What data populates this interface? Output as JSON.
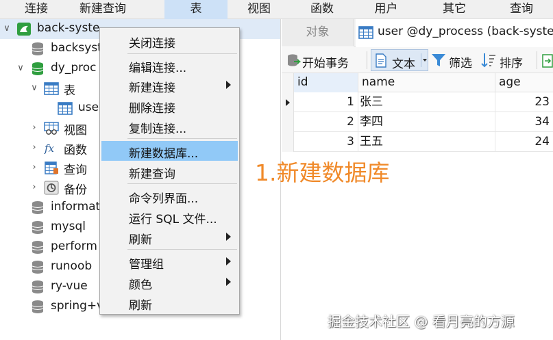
{
  "menubar": {
    "items": [
      {
        "label": "连接",
        "active": false
      },
      {
        "label": "新建查询",
        "active": false
      },
      {
        "label": "表",
        "active": true
      },
      {
        "label": "视图",
        "active": false
      },
      {
        "label": "函数",
        "active": false
      },
      {
        "label": "用户",
        "active": false
      },
      {
        "label": "其它",
        "active": false
      },
      {
        "label": "查询",
        "active": false
      }
    ]
  },
  "tree": {
    "connection": {
      "label": "back-syste",
      "icon": "connection-icon"
    },
    "databases_above": [
      {
        "label": "backsyst",
        "icon": "database-icon"
      }
    ],
    "open_db": {
      "label": "dy_proc",
      "icon": "database-open-icon"
    },
    "tables_node": {
      "label": "表",
      "icon": "table-folder-icon"
    },
    "table_item": {
      "label": "use",
      "icon": "table-icon"
    },
    "views_node": {
      "label": "视图",
      "icon": "view-icon"
    },
    "functions_node": {
      "label": "函数",
      "icon": "function-icon"
    },
    "queries_node": {
      "label": "查询",
      "icon": "query-icon"
    },
    "backup_node": {
      "label": "备份",
      "icon": "backup-icon"
    },
    "databases_below": [
      {
        "label": "informat",
        "icon": "database-icon"
      },
      {
        "label": "mysql",
        "icon": "database-icon"
      },
      {
        "label": "perform",
        "icon": "database-icon"
      },
      {
        "label": "runoob",
        "icon": "database-icon"
      },
      {
        "label": "ry-vue",
        "icon": "database-icon"
      },
      {
        "label": "spring+v",
        "icon": "database-icon"
      }
    ]
  },
  "tabs": {
    "objects_label": "对象",
    "table_tab_label": "user @dy_process (back-syste"
  },
  "toolbar": {
    "begin_transaction": "开始事务",
    "text": "文本",
    "filter": "筛选",
    "sort": "排序"
  },
  "grid": {
    "columns": [
      "id",
      "name",
      "age"
    ],
    "rows": [
      {
        "id": "1",
        "name": "张三",
        "age": "23",
        "current": true
      },
      {
        "id": "2",
        "name": "李四",
        "age": "34",
        "current": false
      },
      {
        "id": "3",
        "name": "王五",
        "age": "24",
        "current": false
      }
    ]
  },
  "context_menu": {
    "items": [
      {
        "label": "关闭连接",
        "submenu": false,
        "highlighted": false
      },
      {
        "label": "编辑连接...",
        "submenu": false,
        "highlighted": false
      },
      {
        "label": "新建连接",
        "submenu": true,
        "highlighted": false
      },
      {
        "label": "删除连接",
        "submenu": false,
        "highlighted": false
      },
      {
        "label": "复制连接...",
        "submenu": false,
        "highlighted": false
      },
      {
        "label": "新建数据库...",
        "submenu": false,
        "highlighted": true
      },
      {
        "label": "新建查询",
        "submenu": false,
        "highlighted": false
      },
      {
        "label": "命令列界面...",
        "submenu": false,
        "highlighted": false
      },
      {
        "label": "运行 SQL 文件...",
        "submenu": false,
        "highlighted": false
      },
      {
        "label": "刷新",
        "submenu": true,
        "highlighted": false
      },
      {
        "label": "管理组",
        "submenu": true,
        "highlighted": false
      },
      {
        "label": "颜色",
        "submenu": true,
        "highlighted": false
      },
      {
        "label": "刷新",
        "submenu": false,
        "highlighted": false
      }
    ]
  },
  "annotation": "1.新建数据库",
  "watermark": "掘金技术社区 @ 看月亮的方源",
  "colors": {
    "accent": "#91c9f7",
    "annotation": "#f08a2a",
    "db_icon": "#8a8a8a",
    "db_open_icon": "#2f9e3f",
    "table_icon": "#3a7cc4"
  }
}
